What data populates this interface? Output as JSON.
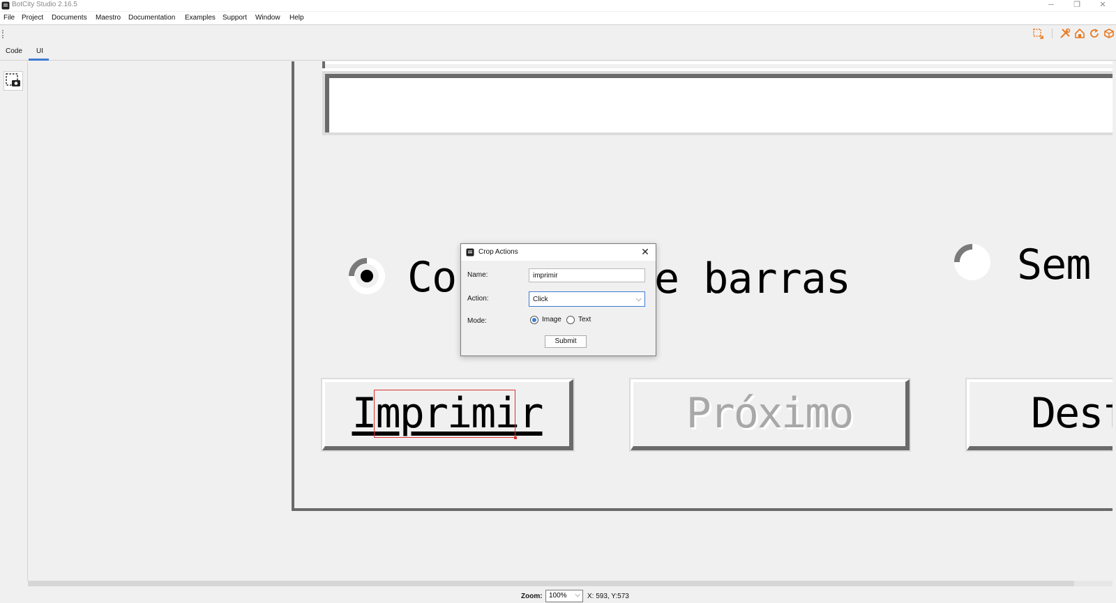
{
  "window": {
    "title": "BotCity Studio 2.16.5",
    "minimize_glyph": "─",
    "restore_glyph": "❐",
    "close_glyph": "✕"
  },
  "menu": [
    "File",
    "Project",
    "Documents",
    "Maestro",
    "Documentation",
    "Examples",
    "Support",
    "Window",
    "Help"
  ],
  "tabs": {
    "code": "Code",
    "ui": "UI",
    "active": "UI"
  },
  "toolbar_icons": [
    "crop-icon",
    "tools-icon",
    "home-icon",
    "refresh-icon",
    "package-icon"
  ],
  "colors": {
    "accent": "#3c7bd2",
    "toolbar_orange": "#e8781e",
    "crop_red": "#e03030"
  },
  "canvas": {
    "radio1_label_left": "Co",
    "radio1_label_right": "e barras",
    "radio2_label": "Sem",
    "button1_label": "Imprimir",
    "button2_label": "Próximo",
    "button3_label": "Desf"
  },
  "dialog": {
    "title": "Crop Actions",
    "close_glyph": "✕",
    "name_label": "Name:",
    "name_value": "imprimir",
    "action_label": "Action:",
    "action_value": "Click",
    "mode_label": "Mode:",
    "mode_option_image": "Image",
    "mode_option_text": "Text",
    "mode_selected": "Image",
    "submit_label": "Submit",
    "chevron_glyph": "⌵"
  },
  "statusbar": {
    "zoom_label": "Zoom:",
    "zoom_value": "100%",
    "coords": "X: 593, Y:573",
    "chevron_glyph": "⌵"
  }
}
